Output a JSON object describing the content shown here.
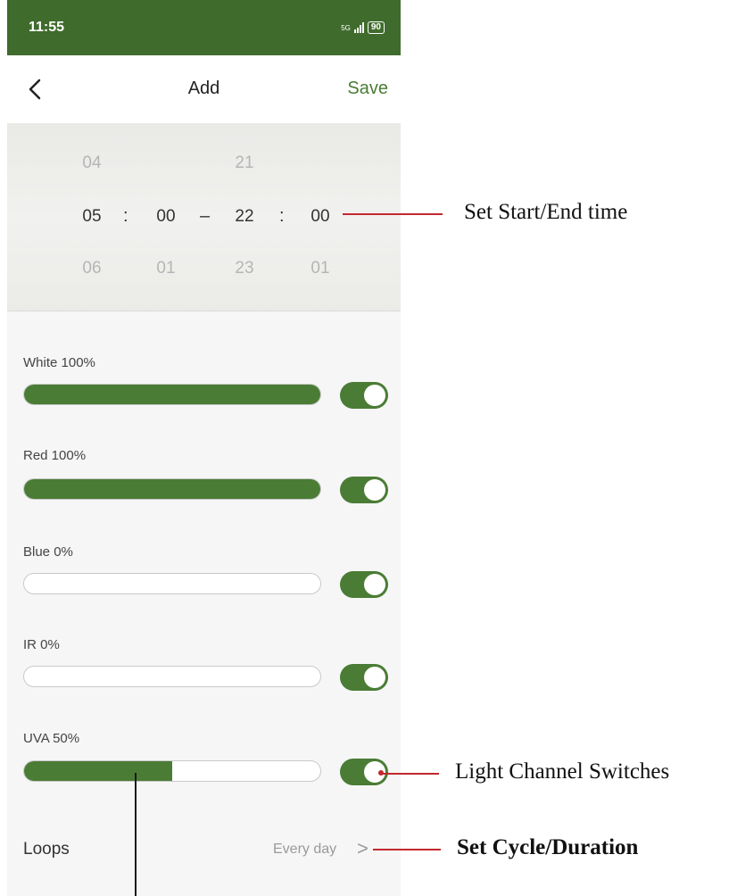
{
  "status_bar": {
    "time": "11:55",
    "network": "5G",
    "battery": "90"
  },
  "nav": {
    "title": "Add",
    "save_label": "Save"
  },
  "time_picker": {
    "columns": [
      {
        "above": "04",
        "selected": "05",
        "below": "06"
      },
      {
        "above": "",
        "selected": "00",
        "below": "01"
      },
      {
        "above": "21",
        "selected": "22",
        "below": "23"
      },
      {
        "above": "",
        "selected": "00",
        "below": "01"
      }
    ],
    "colon": ":",
    "dash": "–"
  },
  "channels": [
    {
      "label": "White 100%",
      "level_percent": 100,
      "enabled": true
    },
    {
      "label": "Red 100%",
      "level_percent": 100,
      "enabled": true
    },
    {
      "label": "Blue 0%",
      "level_percent": 0,
      "enabled": true
    },
    {
      "label": "IR 0%",
      "level_percent": 0,
      "enabled": true
    },
    {
      "label": "UVA 50%",
      "level_percent": 50,
      "enabled": true
    }
  ],
  "loops": {
    "label": "Loops",
    "value": "Every day",
    "chevron": ">"
  },
  "annotations": {
    "time": "Set Start/End time",
    "switches": "Light Channel Switches",
    "cycle": "Set Cycle/Duration"
  },
  "colors": {
    "accent": "#4a7c35",
    "status_bar": "#3f6b2c",
    "annotation_line": "#c2282e"
  }
}
